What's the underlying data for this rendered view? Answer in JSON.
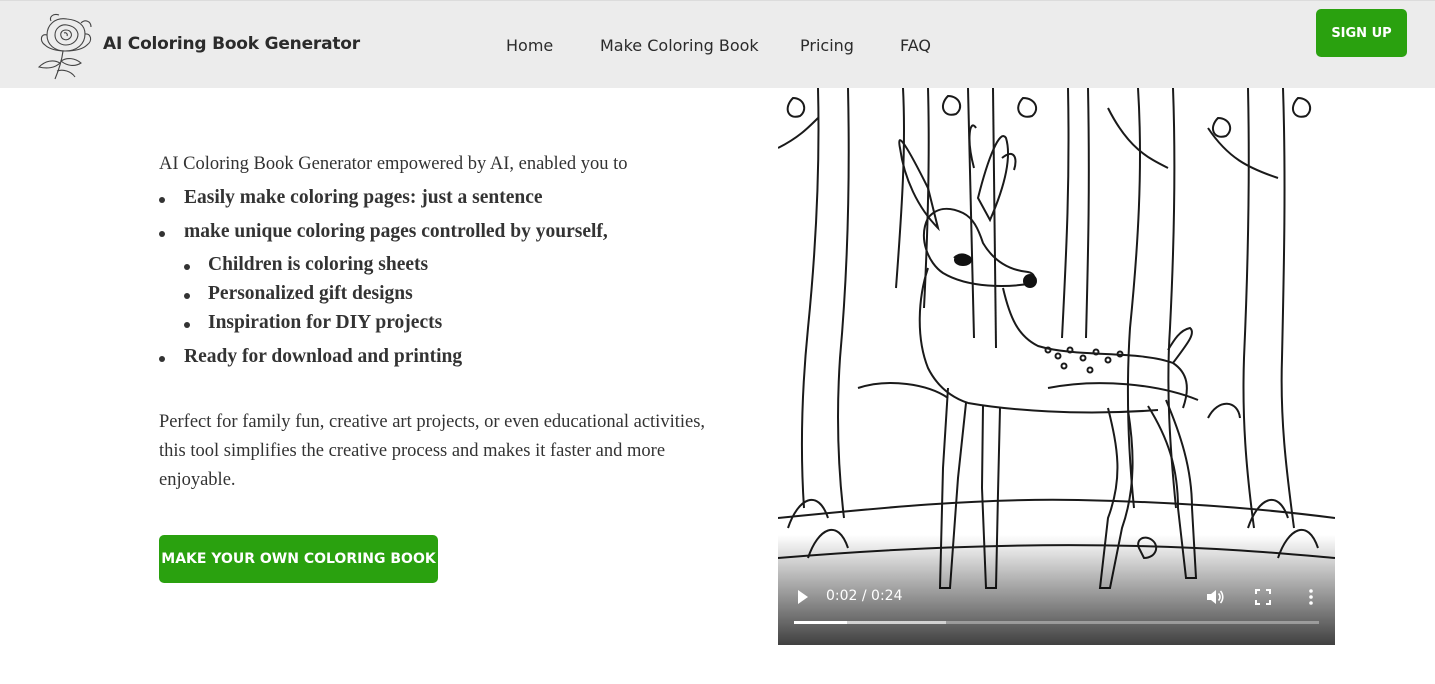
{
  "header": {
    "brand": "AI Coloring Book Generator",
    "logo_icon": "rose-icon",
    "nav": [
      "Home",
      "Make Coloring Book",
      "Pricing",
      "FAQ"
    ],
    "signup_label": "SIGN UP"
  },
  "content": {
    "intro": "AI Coloring Book Generator empowered by AI, enabled you to",
    "features": [
      "Easily make coloring pages: just a sentence",
      "make unique coloring pages controlled by yourself,",
      "Children is coloring sheets",
      "Personalized gift designs",
      "Inspiration for DIY projects",
      "Ready for download and printing"
    ],
    "paragraph": "Perfect for family fun, creative art projects, or even educational activities, this tool simplifies the creative process and makes it faster and more enjoyable.",
    "cta_label": "MAKE YOUR OWN COLORING BOOK"
  },
  "video": {
    "time": "0:02 / 0:24",
    "played_fraction": 0.1,
    "buffered_fraction": 0.29,
    "icons": [
      "play-icon",
      "volume-icon",
      "fullscreen-icon",
      "more-options-icon"
    ]
  },
  "colors": {
    "accent_green": "#2aa10f",
    "header_bg": "#ececec"
  }
}
